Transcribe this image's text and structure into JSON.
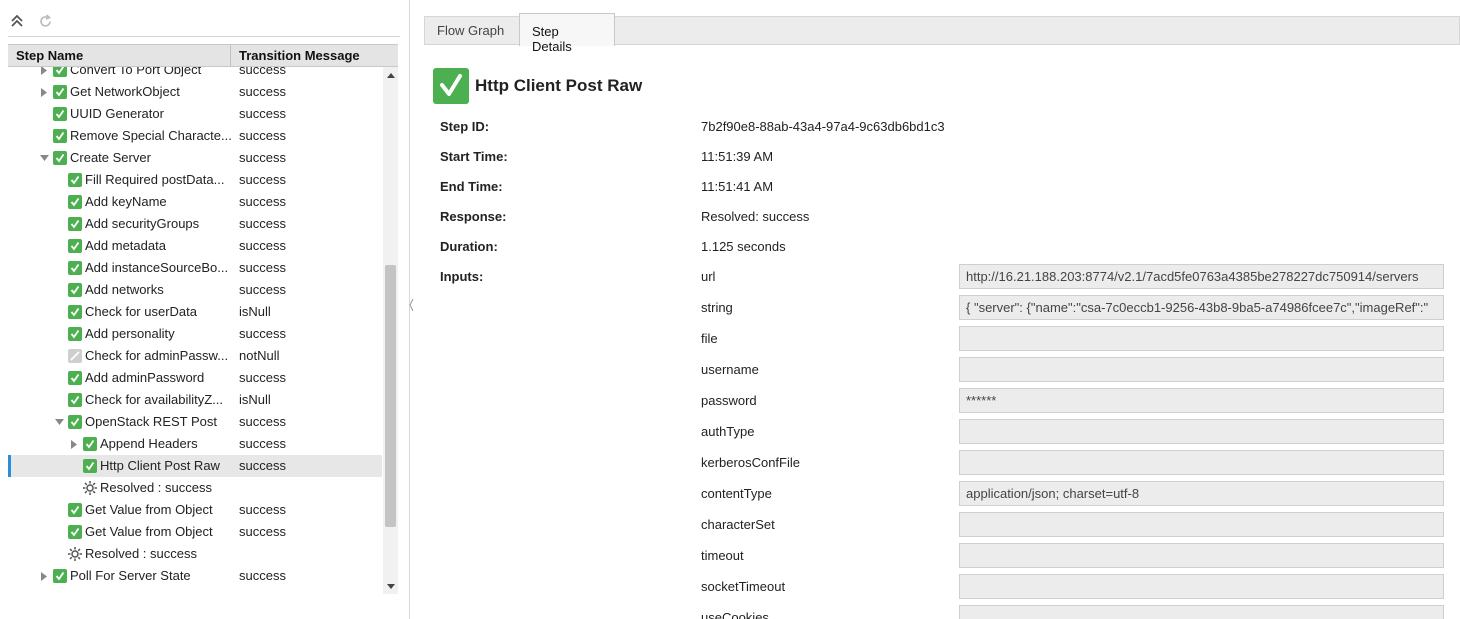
{
  "toolbar": {
    "collapse_icon": "collapse-all-icon",
    "refresh_icon": "refresh-icon"
  },
  "grid": {
    "headers": {
      "step_name": "Step Name",
      "transition_message": "Transition Message"
    },
    "rows": [
      {
        "label": "Convert To Port Object",
        "message": "success",
        "icon": "check",
        "expander": "collapsed"
      },
      {
        "label": "Get NetworkObject",
        "message": "success",
        "icon": "check",
        "expander": "collapsed"
      },
      {
        "label": "UUID Generator",
        "message": "success",
        "icon": "check",
        "expander": ""
      },
      {
        "label": "Remove Special Characte...",
        "message": "success",
        "icon": "check",
        "expander": ""
      },
      {
        "label": "Create Server",
        "message": "success",
        "icon": "check",
        "expander": "expanded"
      },
      {
        "label": "Fill Required postData...",
        "message": "success",
        "icon": "check",
        "expander": ""
      },
      {
        "label": "Add keyName",
        "message": "success",
        "icon": "check",
        "expander": ""
      },
      {
        "label": "Add securityGroups",
        "message": "success",
        "icon": "check",
        "expander": ""
      },
      {
        "label": "Add metadata",
        "message": "success",
        "icon": "check",
        "expander": ""
      },
      {
        "label": "Add instanceSourceBo...",
        "message": "success",
        "icon": "check",
        "expander": ""
      },
      {
        "label": "Add networks",
        "message": "success",
        "icon": "check",
        "expander": ""
      },
      {
        "label": "Check for userData",
        "message": "isNull",
        "icon": "check",
        "expander": ""
      },
      {
        "label": "Add personality",
        "message": "success",
        "icon": "check",
        "expander": ""
      },
      {
        "label": "Check for adminPassw...",
        "message": "notNull",
        "icon": "skipped",
        "expander": ""
      },
      {
        "label": "Add adminPassword",
        "message": "success",
        "icon": "check",
        "expander": ""
      },
      {
        "label": "Check for availabilityZ...",
        "message": "isNull",
        "icon": "check",
        "expander": ""
      },
      {
        "label": "OpenStack REST Post",
        "message": "success",
        "icon": "check",
        "expander": "expanded"
      },
      {
        "label": "Append Headers",
        "message": "success",
        "icon": "check",
        "expander": "collapsed"
      },
      {
        "label": "Http Client Post Raw",
        "message": "success",
        "icon": "check",
        "expander": ""
      },
      {
        "label": "Resolved : success",
        "message": "",
        "icon": "gear",
        "expander": ""
      },
      {
        "label": "Get Value from Object",
        "message": "success",
        "icon": "check",
        "expander": ""
      },
      {
        "label": "Get Value from Object",
        "message": "success",
        "icon": "check",
        "expander": ""
      },
      {
        "label": "Resolved : success",
        "message": "",
        "icon": "gear",
        "expander": ""
      },
      {
        "label": "Poll For Server State",
        "message": "success",
        "icon": "check",
        "expander": "collapsed"
      }
    ]
  },
  "tabs": [
    {
      "label": "Flow Graph",
      "active": false
    },
    {
      "label": "Step Details",
      "active": true
    }
  ],
  "details": {
    "title": "Http Client Post Raw",
    "step_id_label": "Step ID:",
    "step_id": "7b2f90e8-88ab-43a4-97a4-9c63db6bd1c3",
    "start_time_label": "Start Time:",
    "start_time": "11:51:39 AM",
    "end_time_label": "End Time:",
    "end_time": "11:51:41 AM",
    "response_label": "Response:",
    "response": "Resolved: success",
    "duration_label": "Duration:",
    "duration": "1.125 seconds",
    "inputs_label": "Inputs:",
    "inputs": [
      {
        "name": "url",
        "value": "http://16.21.188.203:8774/v2.1/7acd5fe0763a4385be278227dc750914/servers"
      },
      {
        "name": "string",
        "value": "{    \"server\": {\"name\":\"csa-7c0eccb1-9256-43b8-9ba5-a74986fcee7c\",\"imageRef\":\""
      },
      {
        "name": "file",
        "value": ""
      },
      {
        "name": "username",
        "value": ""
      },
      {
        "name": "password",
        "value": "******"
      },
      {
        "name": "authType",
        "value": ""
      },
      {
        "name": "kerberosConfFile",
        "value": ""
      },
      {
        "name": "contentType",
        "value": "application/json; charset=utf-8"
      },
      {
        "name": "characterSet",
        "value": ""
      },
      {
        "name": "timeout",
        "value": ""
      },
      {
        "name": "socketTimeout",
        "value": ""
      },
      {
        "name": "useCookies",
        "value": ""
      }
    ]
  },
  "colors": {
    "success_green": "#4caf50",
    "selection_marker": "#2a8fd6"
  }
}
